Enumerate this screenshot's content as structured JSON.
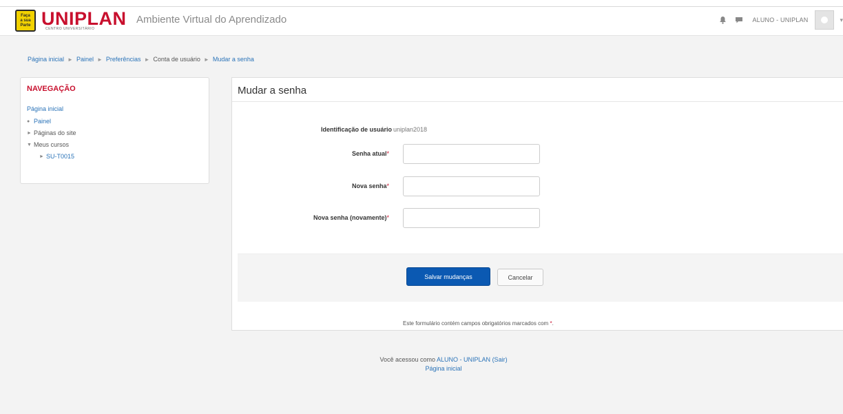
{
  "header": {
    "logo_badge_lines": [
      "Faça",
      "a sua",
      "Parte"
    ],
    "brand_name": "UNIPLAN",
    "brand_subtitle": "CENTRO UNIVERSITÁRIO",
    "site_name": "Ambiente Virtual do Aprendizado",
    "user_name": "ALUNO - UNIPLAN",
    "icons": [
      "bell-icon",
      "chat-icon",
      "avatar",
      "caret-down-icon"
    ]
  },
  "breadcrumb": {
    "items": [
      {
        "label": "Página inicial",
        "link": true
      },
      {
        "label": "Painel",
        "link": true
      },
      {
        "label": "Preferências",
        "link": true
      },
      {
        "label": "Conta de usuário",
        "link": false
      },
      {
        "label": "Mudar a senha",
        "link": true
      }
    ],
    "separator": "►"
  },
  "navigation": {
    "title": "NAVEGAÇÃO",
    "home": "Página inicial",
    "items": [
      {
        "label": "Painel",
        "marker": "●",
        "link": true
      },
      {
        "label": "Páginas do site",
        "marker": "►",
        "link": false
      },
      {
        "label": "Meus cursos",
        "marker": "▼",
        "link": false
      },
      {
        "label": "SU-T0015",
        "marker": "►",
        "link": true
      }
    ]
  },
  "form": {
    "title": "Mudar a senha",
    "username_label": "Identificação de usuário",
    "username_value": "uniplan2018",
    "current_password_label": "Senha atual",
    "new_password_label": "Nova senha",
    "new_password_again_label": "Nova senha (novamente)",
    "required_marker": "*",
    "save_label": "Salvar mudanças",
    "cancel_label": "Cancelar",
    "required_note": "Este formulário contém campos obrigatórios marcados com",
    "required_note_end": "."
  },
  "footer": {
    "logged_in_prefix": "Você acessou como",
    "logged_in_user": "ALUNO - UNIPLAN",
    "logout_label": "(Sair)",
    "home_link": "Página inicial"
  },
  "colors": {
    "brand_red": "#c8102e",
    "link_blue": "#2a73b8",
    "primary_button": "#0b59b2",
    "logo_yellow": "#f2d200"
  }
}
